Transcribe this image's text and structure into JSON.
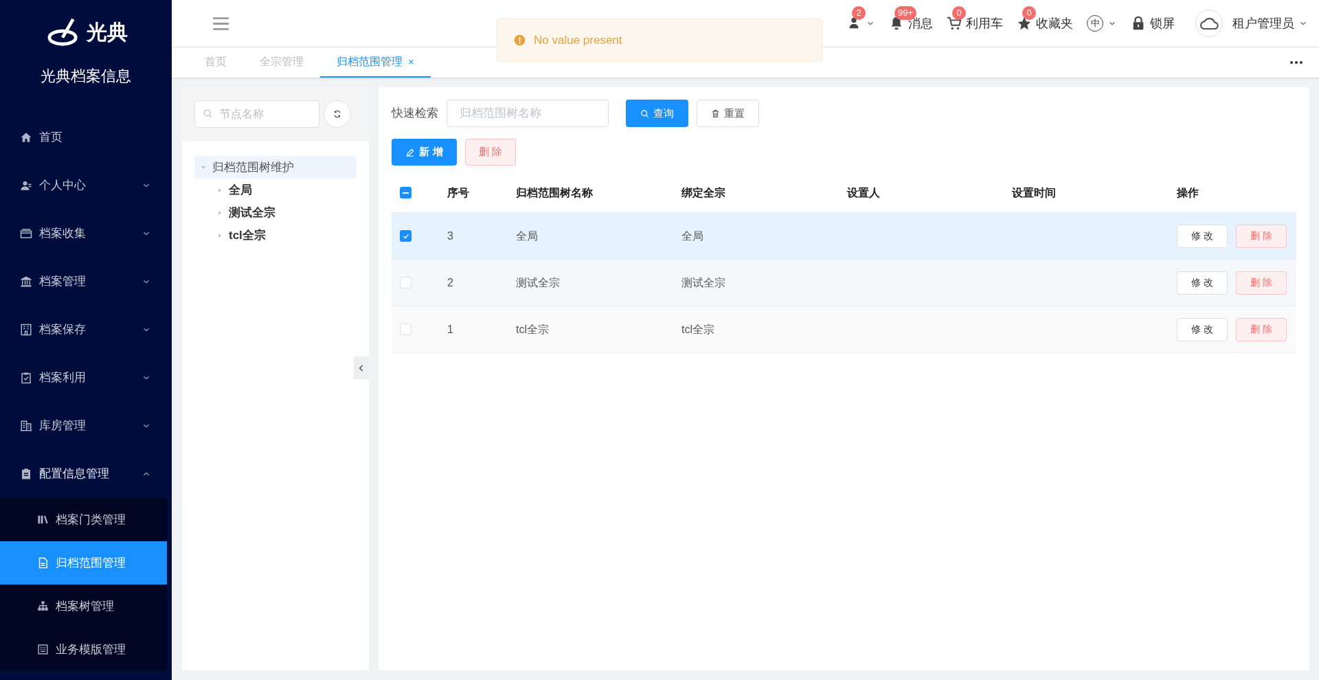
{
  "sidebar": {
    "brand": "光典",
    "title": "光典档案信息",
    "items": [
      {
        "label": "首页"
      },
      {
        "label": "个人中心",
        "expanded": false
      },
      {
        "label": "档案收集",
        "expanded": false
      },
      {
        "label": "档案管理",
        "expanded": false
      },
      {
        "label": "档案保存",
        "expanded": false
      },
      {
        "label": "档案利用",
        "expanded": false
      },
      {
        "label": "库房管理",
        "expanded": false
      },
      {
        "label": "配置信息管理",
        "expanded": true,
        "children": [
          {
            "label": "档案门类管理",
            "selected": false
          },
          {
            "label": "归档范围管理",
            "selected": true
          },
          {
            "label": "档案树管理",
            "selected": false
          },
          {
            "label": "业务模版管理",
            "selected": false
          }
        ]
      }
    ]
  },
  "header": {
    "items": [
      {
        "kind": "hidden",
        "badge": "2"
      },
      {
        "kind": "bell",
        "label": "消息",
        "badge": "99+"
      },
      {
        "kind": "cart",
        "label": "利用车",
        "badge": "0"
      },
      {
        "kind": "star",
        "label": "收藏夹",
        "badge": "0"
      },
      {
        "kind": "lang",
        "label": "中"
      },
      {
        "kind": "lock",
        "label": "锁屏"
      },
      {
        "kind": "user",
        "label": "租户管理员"
      }
    ]
  },
  "toast": {
    "message": "No value present"
  },
  "tabs": [
    {
      "label": "首页",
      "selected": false
    },
    {
      "label": "全宗管理",
      "selected": false
    },
    {
      "label": "归档范围管理",
      "selected": true,
      "close": "×"
    }
  ],
  "tree_panel": {
    "search": {
      "placeholder": "节点名称"
    },
    "tree": [
      {
        "label": "归档范围树维护",
        "expanded": true,
        "children": [
          {
            "label": "全局",
            "expanded": false
          },
          {
            "label": "测试全宗",
            "expanded": false
          },
          {
            "label": "tcl全宗",
            "expanded": false
          }
        ]
      }
    ]
  },
  "filter": {
    "label": "快速检索",
    "placeholder": "归档范围树名称",
    "search_button": "查询",
    "reset_button": "重置"
  },
  "actions": {
    "add_button": "新 增",
    "delete_button": "删 除"
  },
  "table": {
    "columns": [
      "序号",
      "归档范围树名称",
      "绑定全宗",
      "设置人",
      "设置时间",
      "操作"
    ],
    "header_indeterminate": true,
    "rows": [
      {
        "selected": true,
        "index": "3",
        "name": "全局",
        "fonds": "全局",
        "edit": "修 改",
        "delete": "删 除"
      },
      {
        "selected": false,
        "index": "2",
        "name": "测试全宗",
        "fonds": "测试全宗",
        "edit": "修 改",
        "delete": "删 除"
      },
      {
        "selected": false,
        "index": "1",
        "name": "tcl全宗",
        "fonds": "tcl全宗",
        "edit": "修 改",
        "delete": "删 除"
      }
    ]
  }
}
